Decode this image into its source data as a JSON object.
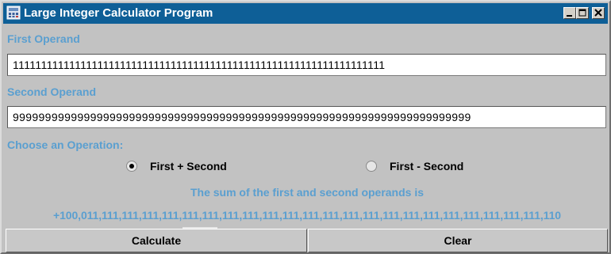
{
  "window": {
    "title": "Large Integer Calculator Program"
  },
  "first_operand": {
    "label": "First Operand",
    "value": "111111111111111111111111111111111111111111111111111111111111111111"
  },
  "second_operand": {
    "label": "Second Operand",
    "value": "99999999999999999999999999999999999999999999999999999999999999999999999"
  },
  "operation": {
    "label": "Choose an Operation:",
    "options": [
      {
        "label": "First + Second",
        "selected": true
      },
      {
        "label": "First - Second",
        "selected": false
      }
    ]
  },
  "result": {
    "caption": "The sum of the first and second operands is",
    "value": "+100,011,111,111,111,111,111,111,111,111,111,111,111,111,111,111,111,111,111,111,111,111,111,111,110"
  },
  "buttons": {
    "calculate": "Calculate",
    "clear": "Clear"
  },
  "colors": {
    "title_bar": "#0e5f97",
    "label_text": "#5a9fd0",
    "background": "#c2c2c2"
  },
  "icons": {
    "app": "calculator-app-icon",
    "minimize": "minimize-icon",
    "maximize": "maximize-icon",
    "close": "close-icon"
  }
}
